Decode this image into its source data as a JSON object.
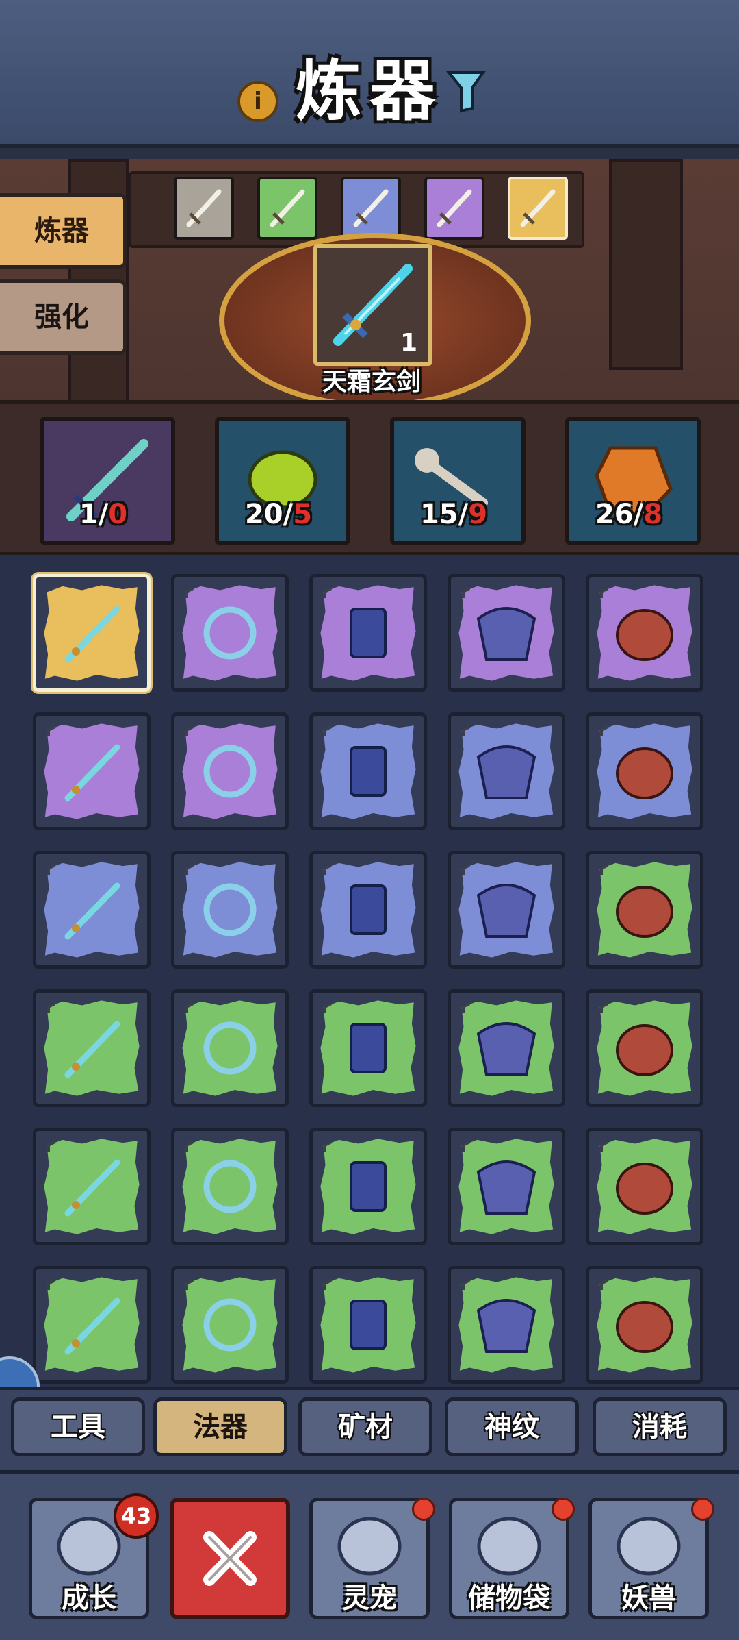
{
  "header": {
    "title": "炼器",
    "info_icon": "info-icon",
    "filter_icon": "filter-icon"
  },
  "side_tabs": [
    {
      "label": "炼器",
      "active": true
    },
    {
      "label": "强化",
      "active": false
    }
  ],
  "rarity_tiers": [
    {
      "name": "white",
      "color": "#a9a39a",
      "selected": false
    },
    {
      "name": "green",
      "color": "#7cc46a",
      "selected": false
    },
    {
      "name": "blue",
      "color": "#7e8ed6",
      "selected": false
    },
    {
      "name": "purple",
      "color": "#a97fd8",
      "selected": false
    },
    {
      "name": "gold",
      "color": "#e8bf5c",
      "selected": true
    }
  ],
  "product": {
    "name": "天霜玄剑",
    "count": "1",
    "icon": "crystal-sword-icon"
  },
  "materials": [
    {
      "icon": "sword-icon",
      "have": "1",
      "need": "0",
      "bg": "#4a3a62"
    },
    {
      "icon": "green-stone-icon",
      "have": "20",
      "need": "5",
      "bg": "#25506a"
    },
    {
      "icon": "bone-staff-icon",
      "have": "15",
      "need": "9",
      "bg": "#25506a"
    },
    {
      "icon": "amber-ore-icon",
      "have": "26",
      "need": "8",
      "bg": "#25506a"
    }
  ],
  "grid_items": [
    {
      "icon": "golden-sword-icon",
      "rarity": "gold",
      "locked": false,
      "selected": true
    },
    {
      "icon": "ring-icon",
      "rarity": "purple",
      "locked": true
    },
    {
      "icon": "bracers-icon",
      "rarity": "purple",
      "locked": true
    },
    {
      "icon": "shoulder-armor-icon",
      "rarity": "purple",
      "locked": true
    },
    {
      "icon": "crest-icon",
      "rarity": "purple",
      "locked": true
    },
    {
      "icon": "blade-icon",
      "rarity": "purple",
      "locked": true
    },
    {
      "icon": "sword-icon",
      "rarity": "purple",
      "locked": true
    },
    {
      "icon": "hoop-ring-icon",
      "rarity": "blue",
      "locked": true
    },
    {
      "icon": "boots-icon",
      "rarity": "blue",
      "locked": true
    },
    {
      "icon": "chest-armor-icon",
      "rarity": "blue",
      "locked": true
    },
    {
      "icon": "mask-icon",
      "rarity": "blue",
      "locked": true
    },
    {
      "icon": "staff-icon",
      "rarity": "blue",
      "locked": true
    },
    {
      "icon": "scimitar-icon",
      "rarity": "blue",
      "locked": true
    },
    {
      "icon": "dagger-icon",
      "rarity": "blue",
      "locked": true
    },
    {
      "icon": "gem-ring-icon",
      "rarity": "green",
      "locked": true
    },
    {
      "icon": "gourd-icon",
      "rarity": "green",
      "locked": true
    },
    {
      "icon": "bangle-icon",
      "rarity": "green",
      "locked": true
    },
    {
      "icon": "whip-icon",
      "rarity": "green",
      "locked": true
    },
    {
      "icon": "loop-ring-icon",
      "rarity": "green",
      "locked": true
    },
    {
      "icon": "leather-boots-icon",
      "rarity": "green",
      "locked": true
    },
    {
      "icon": "gauntlets-icon",
      "rarity": "green",
      "locked": true
    },
    {
      "icon": "vambraces-icon",
      "rarity": "green",
      "locked": true
    },
    {
      "icon": "scroll-guard-icon",
      "rarity": "green",
      "locked": true
    },
    {
      "icon": "leg-guard-icon",
      "rarity": "green",
      "locked": true
    },
    {
      "icon": "vest-icon",
      "rarity": "green",
      "locked": true
    },
    {
      "icon": "heavy-armor-icon",
      "rarity": "green",
      "locked": true
    },
    {
      "icon": "robe-icon",
      "rarity": "green",
      "locked": true
    },
    {
      "icon": "helmet-icon",
      "rarity": "green",
      "locked": true
    },
    {
      "icon": "hood-icon",
      "rarity": "green",
      "locked": true
    },
    {
      "icon": "war-mask-icon",
      "rarity": "green",
      "locked": true
    }
  ],
  "category_tabs": [
    {
      "label": "工具",
      "active": false
    },
    {
      "label": "法器",
      "active": true
    },
    {
      "label": "矿材",
      "active": false
    },
    {
      "label": "神纹",
      "active": false
    },
    {
      "label": "消耗",
      "active": false
    }
  ],
  "bottom_nav": [
    {
      "label": "成长",
      "badge": "43",
      "icon": "cards-icon"
    },
    {
      "label": "",
      "icon": "close-icon"
    },
    {
      "label": "灵宠",
      "icon": "pet-egg-icon",
      "dot": true
    },
    {
      "label": "储物袋",
      "icon": "bag-icon",
      "dot": true
    },
    {
      "label": "妖兽",
      "icon": "beast-icon",
      "dot": true
    }
  ],
  "colors": {
    "gold": "#e8bf5c",
    "purple": "#a97fd8",
    "blue": "#7e8ed6",
    "green": "#7cc46a",
    "need_red": "#e0302a"
  }
}
